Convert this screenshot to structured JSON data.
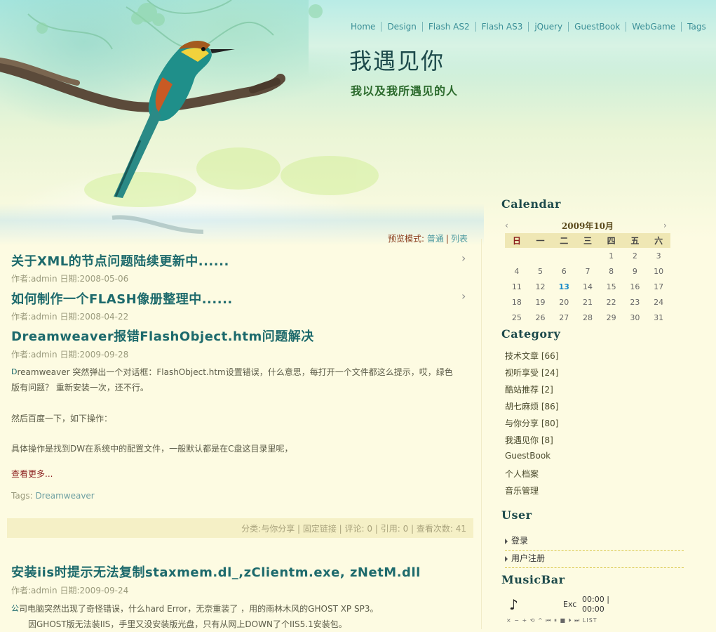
{
  "nav": [
    "Home",
    "Design",
    "Flash AS2",
    "Flash AS3",
    "jQuery",
    "GuestBook",
    "WebGame",
    "Tags"
  ],
  "site": {
    "title": "我遇见你",
    "subtitle": "我以及我所遇见的人"
  },
  "view_mode": {
    "label": "预览模式:",
    "normal": "普通",
    "sep": "|",
    "list": "列表"
  },
  "posts": [
    {
      "title": "关于XML的节点问题陆续更新中......",
      "meta": "作者:admin  日期:2008-05-06"
    },
    {
      "title": "如何制作一个FLASH像册整理中......",
      "meta": "作者:admin  日期:2008-04-22"
    },
    {
      "title": "Dreamweaver报错FlashObject.htm问题解决",
      "meta": "作者:admin  日期:2009-09-28",
      "p1_initial": "D",
      "p1": "reamweaver 突然弹出一个对话框：FlashObject.htm设置错误，什么意思，每打开一个文件都这么提示，哎，绿色",
      "p1b": "版有问题？ 重新安装一次，还不行。",
      "p2": "然后百度一下，如下操作：",
      "p3": "具体操作是找到DW在系统中的配置文件，一般默认都是在C盘这目录里呢，",
      "more": "查看更多...",
      "tags_label": "Tags: ",
      "tag": "Dreamweaver",
      "footer": "分类:与你分享 | 固定链接 | 评论: 0 | 引用: 0 | 查看次数: 41"
    },
    {
      "title": "安装iis时提示无法复制staxmem.dl_,zClientm.exe, zNetM.dll",
      "meta": "作者:admin  日期:2009-09-24",
      "p1_initial": "公",
      "p1": "司电脑突然出现了奇怪错误，什么hard Error，无奈重装了 ，用的雨林木风的GHOST XP SP3。",
      "p1b": "因GHOST版无法装IIS，手里又没安装版光盘，只有从网上DOWN了个IIS5.1安装包。"
    }
  ],
  "sidebar": {
    "calendar_title": "Calendar",
    "month": "2009年10月",
    "weekdays": [
      "日",
      "一",
      "二",
      "三",
      "四",
      "五",
      "六"
    ],
    "weeks": [
      [
        "",
        "",
        "",
        "",
        "1",
        "2",
        "3"
      ],
      [
        "4",
        "5",
        "6",
        "7",
        "8",
        "9",
        "10"
      ],
      [
        "11",
        "12",
        "13",
        "14",
        "15",
        "16",
        "17"
      ],
      [
        "18",
        "19",
        "20",
        "21",
        "22",
        "23",
        "24"
      ],
      [
        "25",
        "26",
        "27",
        "28",
        "29",
        "30",
        "31"
      ]
    ],
    "today": "13",
    "category_title": "Category",
    "categories": [
      "技术文章 [66]",
      "视听享受 [24]",
      "酷站推荐 [2]",
      "胡七麻烦 [86]",
      "与你分享 [80]",
      "我遇见你 [8]",
      "GuestBook",
      "个人档案",
      "音乐管理"
    ],
    "user_title": "User",
    "user_links": [
      "登录",
      "用户注册"
    ],
    "musicbar_title": "MusicBar",
    "music": {
      "exc": "Exc",
      "time1": "00:00 |",
      "time2": "00:00",
      "controls": "× − + ⟲ ^   ⏮ ⏸ ■ ⏵ ⏭ LIST"
    }
  }
}
